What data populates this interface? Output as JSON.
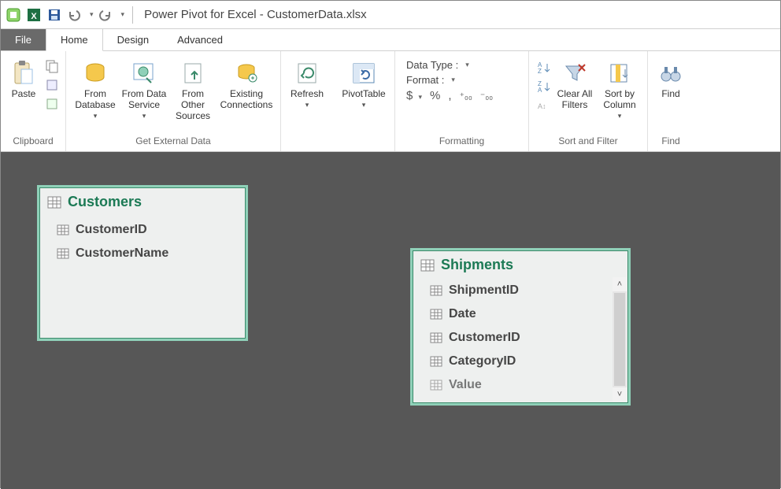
{
  "titlebar": {
    "title": "Power Pivot for Excel - CustomerData.xlsx"
  },
  "tabs": {
    "file": "File",
    "home": "Home",
    "design": "Design",
    "advanced": "Advanced"
  },
  "ribbon": {
    "clipboard": {
      "label": "Clipboard",
      "paste": "Paste"
    },
    "getdata": {
      "label": "Get External Data",
      "from_database": "From\nDatabase",
      "from_data_service": "From Data\nService",
      "from_other_sources": "From Other\nSources",
      "existing_connections": "Existing\nConnections"
    },
    "refresh": "Refresh",
    "pivottable": "PivotTable",
    "formatting": {
      "label": "Formatting",
      "data_type": "Data Type :",
      "format": "Format :",
      "currency": "$",
      "percent": "%",
      "comma": ",",
      "inc": ".0",
      "dec": ".0"
    },
    "sortfilter": {
      "label": "Sort and Filter",
      "clear_filters": "Clear All\nFilters",
      "sort_by_column": "Sort by\nColumn"
    },
    "find": {
      "label": "Find",
      "find": "Find"
    }
  },
  "diagram": {
    "customers": {
      "title": "Customers",
      "fields": [
        "CustomerID",
        "CustomerName"
      ]
    },
    "shipments": {
      "title": "Shipments",
      "fields": [
        "ShipmentID",
        "Date",
        "CustomerID",
        "CategoryID",
        "Value"
      ]
    }
  }
}
